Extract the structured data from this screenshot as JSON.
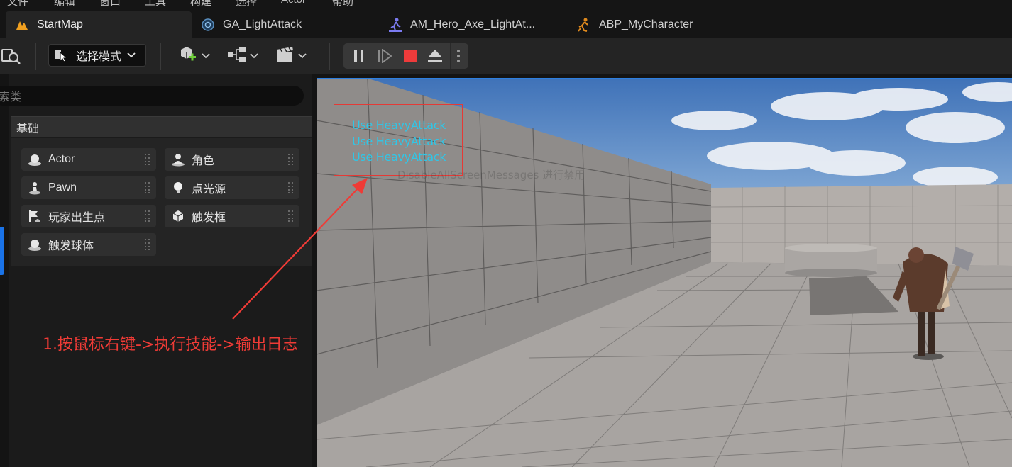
{
  "menu": {
    "items": [
      "文件",
      "编辑",
      "窗口",
      "工具",
      "构建",
      "选择",
      "Actor",
      "帮助"
    ]
  },
  "tabs": [
    {
      "label": "StartMap",
      "icon": "level-map-icon",
      "active": true
    },
    {
      "label": "GA_LightAttack",
      "icon": "blueprint-icon",
      "active": false
    },
    {
      "label": "AM_Hero_Axe_LightAt...",
      "icon": "anim-montage-icon",
      "active": false
    },
    {
      "label": "ABP_MyCharacter",
      "icon": "anim-blueprint-icon",
      "active": false
    }
  ],
  "toolbar": {
    "mode_label": "选择模式"
  },
  "place_actors": {
    "search_placeholder": "索类",
    "category": "基础",
    "items": [
      {
        "label": "Actor",
        "icon": "actor-sphere-icon"
      },
      {
        "label": "角色",
        "icon": "character-icon"
      },
      {
        "label": "Pawn",
        "icon": "pawn-icon"
      },
      {
        "label": "点光源",
        "icon": "point-light-icon"
      },
      {
        "label": "玩家出生点",
        "icon": "player-start-icon"
      },
      {
        "label": "触发框",
        "icon": "trigger-box-icon"
      },
      {
        "label": "触发球体",
        "icon": "trigger-sphere-icon"
      }
    ]
  },
  "viewport": {
    "messages": [
      "Use HeavyAttack",
      "Use HeavyAttack",
      "Use HeavyAttack"
    ],
    "faded_message": "DisableAllScreenMessages 进行禁用"
  },
  "annotation": {
    "text": "1.按鼠标右键->执行技能->输出日志"
  },
  "colors": {
    "accent_blue": "#1a73e8",
    "message_cyan": "#2fc7e8",
    "annotation_red": "#ef3b36",
    "stop_red": "#e53935"
  }
}
